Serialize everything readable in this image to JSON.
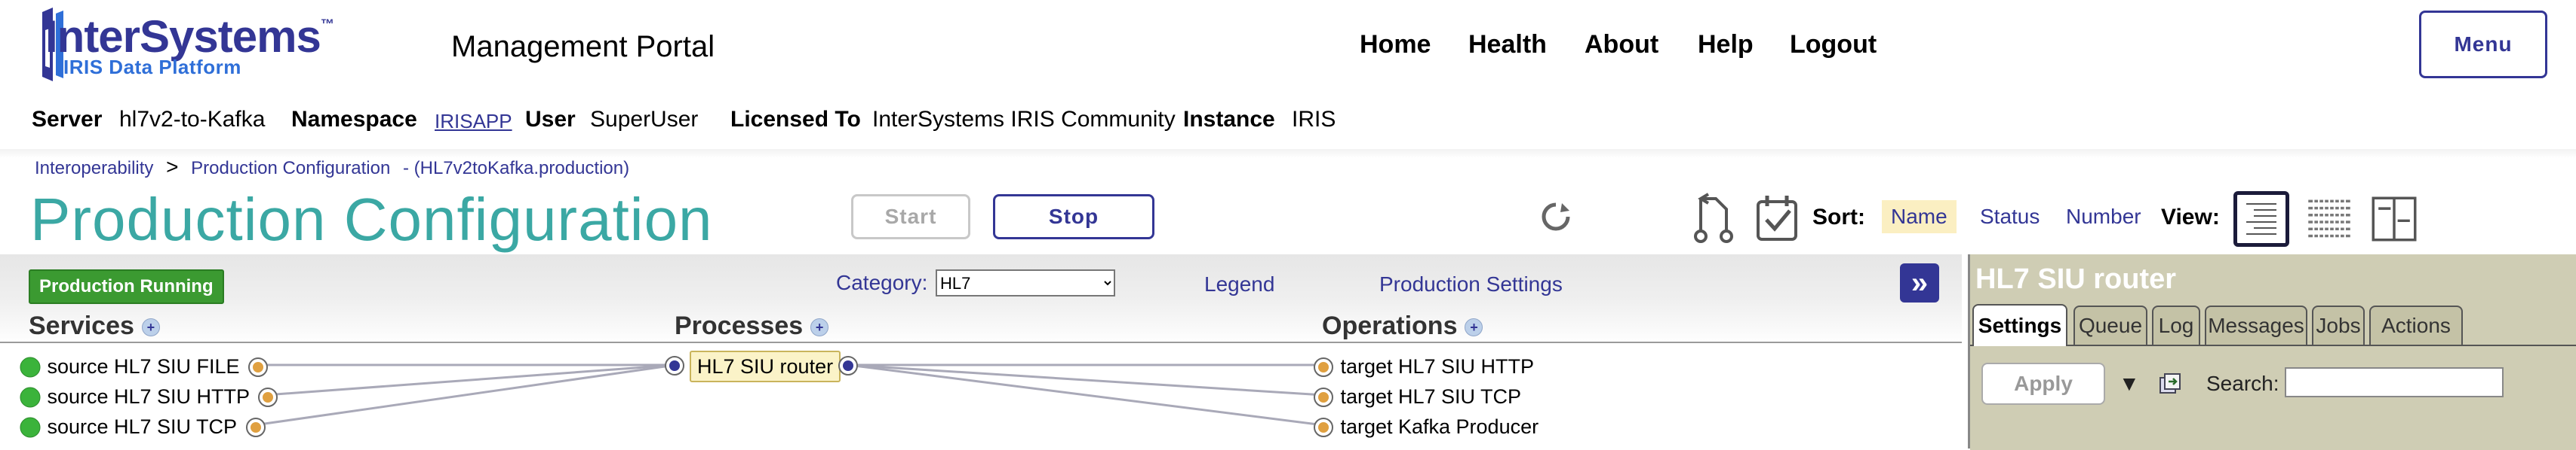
{
  "header": {
    "logo_word": "InterSystems",
    "logo_tm": "™",
    "logo_sub": "IRIS Data Platform",
    "portal_title": "Management Portal",
    "nav": [
      "Home",
      "Health",
      "About",
      "Help",
      "Logout"
    ],
    "menu_label": "Menu"
  },
  "infobar": {
    "server_label": "Server",
    "server_value": "hl7v2-to-Kafka",
    "namespace_label": "Namespace",
    "namespace_value": "IRISAPP",
    "user_label": "User",
    "user_value": "SuperUser",
    "licensed_label": "Licensed To",
    "licensed_value": "InterSystems IRIS Community",
    "instance_label": "Instance",
    "instance_value": "IRIS"
  },
  "breadcrumb": {
    "item1": "Interoperability",
    "separator": ">",
    "item2": "Production Configuration",
    "item3": "- (HL7v2toKafka.production)"
  },
  "page_title": "Production Configuration",
  "controls": {
    "start_label": "Start",
    "stop_label": "Stop",
    "start_enabled": false
  },
  "sort": {
    "label": "Sort:",
    "options": [
      "Name",
      "Status",
      "Number"
    ],
    "selected": "Name"
  },
  "view": {
    "label": "View:",
    "selected": "list"
  },
  "diagram": {
    "status_badge": "Production Running",
    "category_label": "Category:",
    "category_value": "HL7",
    "legend_label": "Legend",
    "settings_label": "Production Settings",
    "collapse_glyph": "»",
    "columns": {
      "services": "Services",
      "processes": "Processes",
      "operations": "Operations"
    },
    "services": [
      "source HL7 SIU FILE",
      "source HL7 SIU HTTP",
      "source HL7 SIU TCP"
    ],
    "processes": [
      "HL7 SIU router"
    ],
    "operations": [
      "target HL7 SIU HTTP",
      "target HL7 SIU TCP",
      "target Kafka Producer"
    ]
  },
  "right_panel": {
    "title": "HL7 SIU router",
    "tabs": [
      "Settings",
      "Queue",
      "Log",
      "Messages",
      "Jobs",
      "Actions"
    ],
    "active_tab": "Settings",
    "apply_label": "Apply",
    "search_label": "Search:",
    "search_value": ""
  },
  "colors": {
    "brand": "#333695",
    "title_teal": "#3ba8a4",
    "running_green": "#3b9a31",
    "status_dot_green": "#3bb33b",
    "connector_orange": "#e0a040",
    "panel_bg": "#cfcdb4"
  }
}
